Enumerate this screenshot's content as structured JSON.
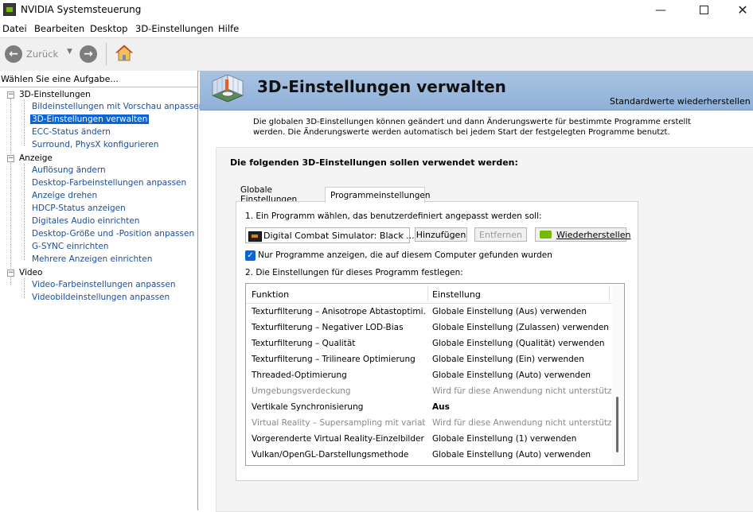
{
  "window": {
    "title": "NVIDIA Systemsteuerung"
  },
  "menu": [
    "Datei",
    "Bearbeiten",
    "Desktop",
    "3D-Einstellungen",
    "Hilfe"
  ],
  "toolbar": {
    "back_label": "Zurück"
  },
  "left_panel": {
    "task_label": "Wählen Sie eine Aufgabe...",
    "tree": [
      {
        "label": "3D-Einstellungen",
        "items": [
          "Bildeinstellungen mit Vorschau anpassen",
          "3D-Einstellungen verwalten",
          "ECC-Status ändern",
          "Surround, PhysX konfigurieren"
        ]
      },
      {
        "label": "Anzeige",
        "items": [
          "Auflösung ändern",
          "Desktop-Farbeinstellungen anpassen",
          "Anzeige drehen",
          "HDCP-Status anzeigen",
          "Digitales Audio einrichten",
          "Desktop-Größe und -Position anpassen",
          "G-SYNC einrichten",
          "Mehrere Anzeigen einrichten"
        ]
      },
      {
        "label": "Video",
        "items": [
          "Video-Farbeinstellungen anpassen",
          "Videobildeinstellungen anpassen"
        ]
      }
    ],
    "selected_item": "3D-Einstellungen verwalten"
  },
  "header": {
    "title": "3D-Einstellungen verwalten",
    "restore_defaults": "Standardwerte wiederherstellen"
  },
  "description": "Die globalen 3D-Einstellungen können geändert und dann Änderungswerte für bestimmte Programme erstellt werden. Die Änderungswerte werden automatisch bei jedem Start der festgelegten Programme benutzt.",
  "main": {
    "section_title": "Die folgenden 3D-Einstellungen sollen verwendet werden:",
    "tabs": [
      "Globale Einstellungen",
      "Programmeinstellungen"
    ],
    "active_tab": 1,
    "step1_label": "1. Ein Programm wählen, das benutzerdefiniert angepasst werden soll:",
    "program_select_value": "Digital Combat Simulator: Black ...",
    "add_button": "Hinzufügen",
    "remove_button": "Entfernen",
    "restore_button": "Wiederherstellen",
    "checkbox_label": "Nur Programme anzeigen, die auf diesem Computer gefunden wurden",
    "step2_label": "2. Die Einstellungen für dieses Programm festlegen:",
    "table": {
      "columns": [
        "Funktion",
        "Einstellung"
      ],
      "rows": [
        {
          "feature": "Texturfilterung – Anisotrope Abtastoptimi...",
          "setting": "Globale Einstellung (Aus) verwenden",
          "state": "normal"
        },
        {
          "feature": "Texturfilterung – Negativer LOD-Bias",
          "setting": "Globale Einstellung (Zulassen) verwenden",
          "state": "normal"
        },
        {
          "feature": "Texturfilterung – Qualität",
          "setting": "Globale Einstellung (Qualität) verwenden",
          "state": "normal"
        },
        {
          "feature": "Texturfilterung – Trilineare Optimierung",
          "setting": "Globale Einstellung (Ein) verwenden",
          "state": "normal"
        },
        {
          "feature": "Threaded-Optimierung",
          "setting": "Globale Einstellung (Auto) verwenden",
          "state": "normal"
        },
        {
          "feature": "Umgebungsverdeckung",
          "setting": "Wird für diese Anwendung nicht unterstützt",
          "state": "disabled"
        },
        {
          "feature": "Vertikale Synchronisierung",
          "setting": "Aus",
          "state": "bold"
        },
        {
          "feature": "Virtual Reality – Supersampling mit variabl...",
          "setting": "Wird für diese Anwendung nicht unterstützt",
          "state": "disabled"
        },
        {
          "feature": "Vorgerenderte Virtual Reality-Einzelbilder",
          "setting": "Globale Einstellung (1) verwenden",
          "state": "normal"
        },
        {
          "feature": "Vulkan/OpenGL-Darstellungsmethode",
          "setting": "Globale Einstellung (Auto) verwenden",
          "state": "normal"
        }
      ]
    }
  }
}
